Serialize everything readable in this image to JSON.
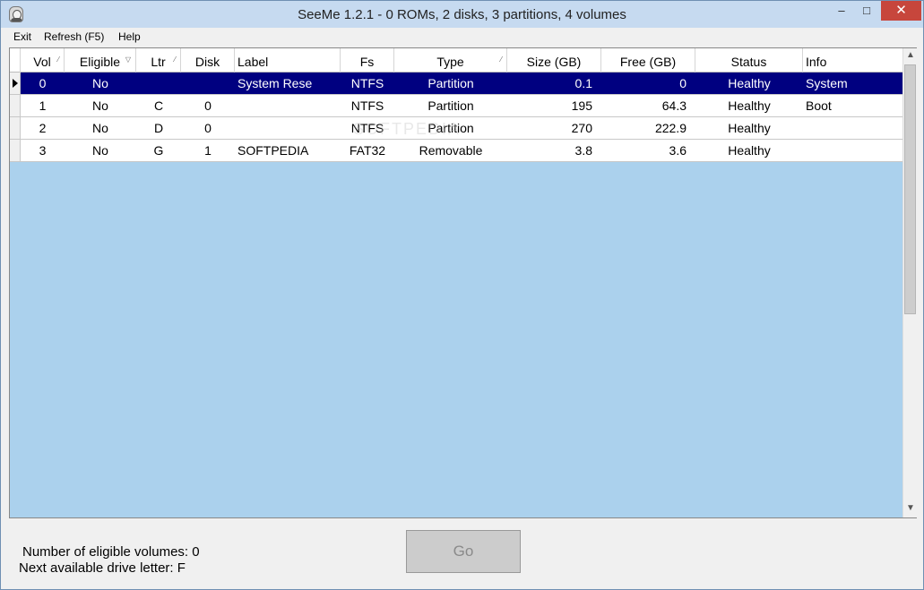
{
  "window": {
    "title": "SeeMe 1.2.1 - 0 ROMs, 2 disks, 3 partitions, 4 volumes",
    "minimize": "–",
    "maximize": "□",
    "close": "✕"
  },
  "menu": {
    "items": [
      "Exit",
      "Refresh (F5)",
      "Help"
    ]
  },
  "table": {
    "columns": [
      "Vol",
      "Eligible",
      "Ltr",
      "Disk",
      "Label",
      "Fs",
      "Type",
      "Size (GB)",
      "Free (GB)",
      "Status",
      "Info"
    ],
    "rows": [
      [
        "0",
        "No",
        "",
        "",
        "System Rese",
        "NTFS",
        "Partition",
        "0.1",
        "0",
        "Healthy",
        "System"
      ],
      [
        "1",
        "No",
        "C",
        "0",
        "",
        "NTFS",
        "Partition",
        "195",
        "64.3",
        "Healthy",
        "Boot"
      ],
      [
        "2",
        "No",
        "D",
        "0",
        "",
        "NTFS",
        "Partition",
        "270",
        "222.9",
        "Healthy",
        ""
      ],
      [
        "3",
        "No",
        "G",
        "1",
        "SOFTPEDIA",
        "FAT32",
        "Removable",
        "3.8",
        "3.6",
        "Healthy",
        ""
      ]
    ]
  },
  "status": {
    "eligible_volumes": "Number of eligible volumes: 0",
    "next_letter": "Next available drive letter: F"
  },
  "go_button": "Go",
  "watermark": "SOFTPEDIA",
  "colors": {
    "selected_row": "#000080",
    "grid_bg": "#abd1ed",
    "titlebar": "#c6daf0",
    "close_button": "#c7463c"
  }
}
